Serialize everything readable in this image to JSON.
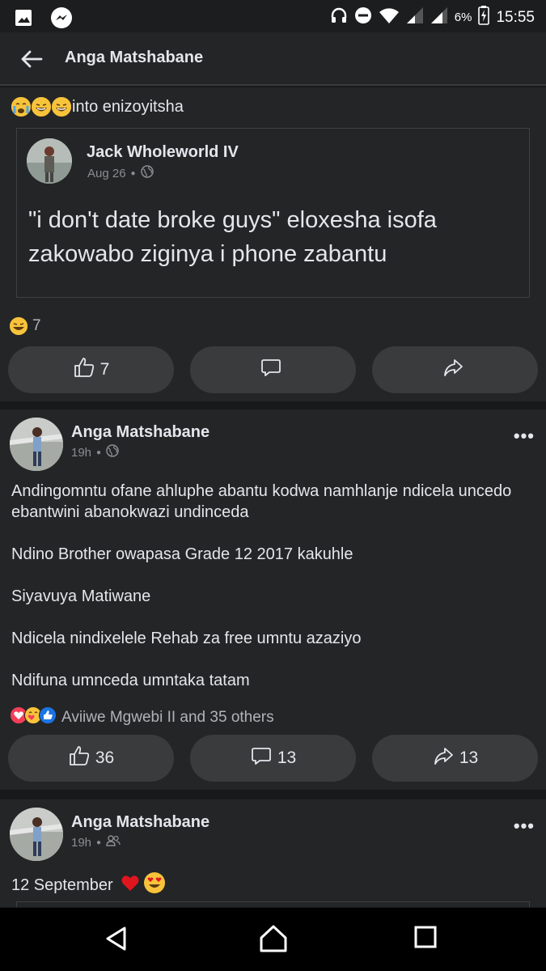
{
  "status_bar": {
    "battery_percent": "6%",
    "time": "15:55"
  },
  "header": {
    "title": "Anga Matshabane"
  },
  "post1": {
    "caption": "into enizoyitsha",
    "shared": {
      "author": "Jack Wholeworld IV",
      "date": "Aug 26",
      "text": "\"i don't date broke guys\" eloxesha isofa zakowabo ziginya i phone zabantu"
    },
    "reaction_count": "7",
    "buttons": {
      "like_count": "7",
      "comment_count": "",
      "share_count": ""
    }
  },
  "post2": {
    "author": "Anga Matshabane",
    "time": "19h",
    "paragraphs": [
      "Andingomntu ofane ahluphe  abantu kodwa namhlanje ndicela uncedo ebantwini abanokwazi undinceda",
      "Ndino  Brother owapasa Grade 12 2017 kakuhle",
      "Siyavuya Matiwane",
      "Ndicela nindixelele Rehab za free umntu azaziyo",
      "Ndifuna umnceda umntaka tatam"
    ],
    "reactions_text": "Aviiwe Mgwebi II and 35 others",
    "buttons": {
      "like_count": "36",
      "comment_count": "13",
      "share_count": "13"
    }
  },
  "post3": {
    "author": "Anga Matshabane",
    "time": "19h",
    "text": "12 September"
  },
  "colors": {
    "background": "#18191a",
    "card": "#242526",
    "pill": "#3a3b3c",
    "muted": "#8a8d91"
  }
}
